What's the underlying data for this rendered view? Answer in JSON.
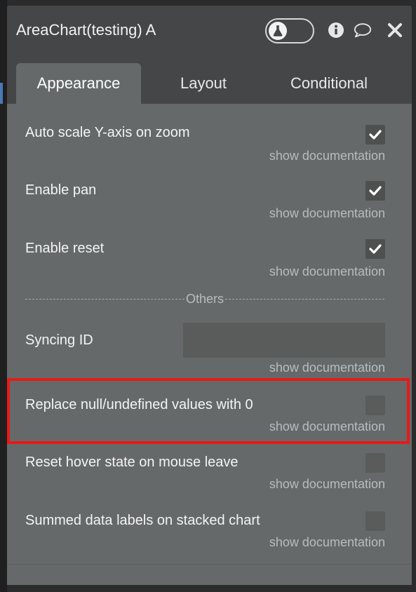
{
  "panel": {
    "title": "AreaChart(testing) A",
    "icons": [
      "flask-icon",
      "info-icon",
      "comment-icon",
      "close-icon"
    ]
  },
  "tabs": [
    {
      "label": "Appearance",
      "active": true
    },
    {
      "label": "Layout",
      "active": false
    },
    {
      "label": "Conditional",
      "active": false
    }
  ],
  "settings": [
    {
      "label": "Auto scale Y-axis on zoom",
      "doc": "show documentation",
      "checked": true
    },
    {
      "label": "Enable pan",
      "doc": "show documentation",
      "checked": true
    },
    {
      "label": "Enable reset",
      "doc": "show documentation",
      "checked": true
    }
  ],
  "separator": {
    "label": "Others"
  },
  "syncing": {
    "label": "Syncing ID",
    "value": "",
    "doc": "show documentation"
  },
  "settings2": [
    {
      "label": "Replace null/undefined values with 0",
      "doc": "show documentation",
      "checked": false
    },
    {
      "label": "Reset hover state on mouse leave",
      "doc": "show documentation",
      "checked": false
    },
    {
      "label": "Summed data labels on stacked chart",
      "doc": "show documentation",
      "checked": false
    }
  ],
  "colors": {
    "panel_bg": "#666969",
    "header_bg": "#444647",
    "highlight": "#e81919"
  }
}
